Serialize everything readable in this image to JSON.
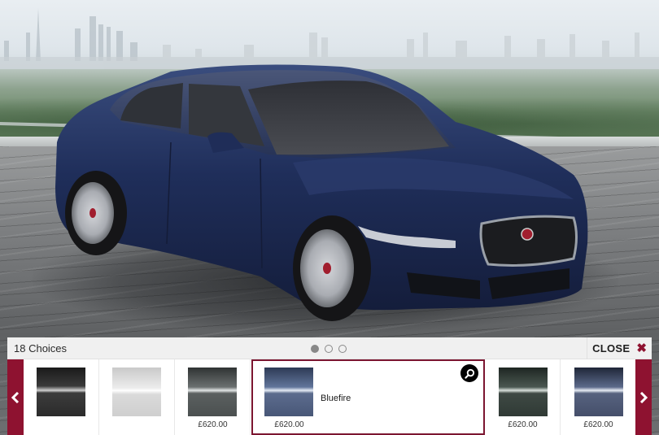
{
  "scene": {
    "description": "Jaguar XE sedan in Bluefire shown on a rooftop deck overlooking a city skyline",
    "car_color": "#1f2e58"
  },
  "colour_picker": {
    "choices_label": "18 Choices",
    "pages": [
      {
        "active": true
      },
      {
        "active": false
      },
      {
        "active": false
      }
    ],
    "close_label": "CLOSE",
    "close_icon": "close-x-icon",
    "prev_icon": "chevron-left-icon",
    "next_icon": "chevron-right-icon",
    "zoom_icon": "magnifier-icon",
    "accent_color": "#8e1230",
    "swatches": [
      {
        "name": "",
        "price": "",
        "color": "#2b2b2b",
        "selected": false
      },
      {
        "name": "",
        "price": "",
        "color": "#dcdcdc",
        "selected": false
      },
      {
        "name": "",
        "price": "£620.00",
        "color": "#555a5a",
        "selected": false
      },
      {
        "name": "Bluefire",
        "price": "£620.00",
        "color": "#4c5b7c",
        "selected": true
      },
      {
        "name": "",
        "price": "£620.00",
        "color": "#343e39",
        "selected": false
      },
      {
        "name": "",
        "price": "£620.00",
        "color": "#48526e",
        "selected": false
      }
    ]
  }
}
